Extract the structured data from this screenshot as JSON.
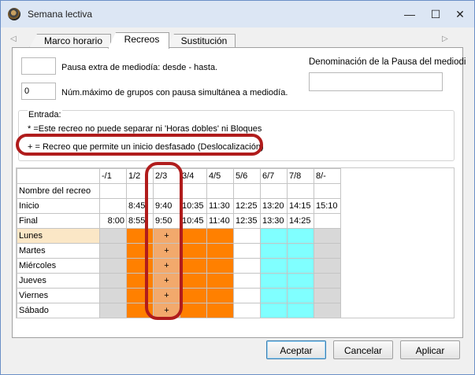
{
  "window": {
    "title": "Semana lectiva",
    "minimize": "—",
    "maximize": "☐",
    "close": "✕"
  },
  "tabs": [
    {
      "label": "Marco horario"
    },
    {
      "label": "Recreos"
    },
    {
      "label": "Sustitución"
    }
  ],
  "tab_scroll": {
    "left": "◁",
    "right": "▷"
  },
  "form": {
    "pause_value": "",
    "pause_label": "Pausa extra de mediodía: desde - hasta.",
    "max_groups_value": "0",
    "max_groups_label": "Núm.máximo de grupos con pausa simultánea a mediodía.",
    "denominacion_label": "Denominación de la Pausa del mediodi",
    "denominacion_value": ""
  },
  "legend": {
    "title": "Entrada:",
    "line1": "* =Este recreo no puede separar ni 'Horas dobles' ni Bloques",
    "line2": "+ = Recreo que permite un inicio desfasado (Deslocalización)"
  },
  "grid": {
    "headers": [
      "",
      "-/1",
      "1/2",
      "2/3",
      "3/4",
      "4/5",
      "5/6",
      "6/7",
      "7/8",
      "8/-"
    ],
    "info_rows": [
      {
        "label": "Nombre del recreo",
        "cells": [
          "",
          "",
          "",
          "",
          "",
          "",
          "",
          "",
          ""
        ]
      },
      {
        "label": "Inicio",
        "cells": [
          "",
          "8:45",
          "9:40",
          "10:35",
          "11:30",
          "12:25",
          "13:20",
          "14:15",
          "15:10"
        ]
      },
      {
        "label": "Final",
        "cells": [
          "8:00",
          "8:55",
          "9:50",
          "10:45",
          "11:40",
          "12:35",
          "13:30",
          "14:25",
          ""
        ]
      }
    ],
    "day_rows": [
      {
        "label": "Lunes",
        "cells": [
          "",
          "",
          "+",
          "",
          "",
          "",
          "",
          "",
          ""
        ]
      },
      {
        "label": "Martes",
        "cells": [
          "",
          "",
          "+",
          "",
          "",
          "",
          "",
          "",
          ""
        ]
      },
      {
        "label": "Miércoles",
        "cells": [
          "",
          "",
          "+",
          "",
          "",
          "",
          "",
          "",
          ""
        ]
      },
      {
        "label": "Jueves",
        "cells": [
          "",
          "",
          "+",
          "",
          "",
          "",
          "",
          "",
          ""
        ]
      },
      {
        "label": "Viernes",
        "cells": [
          "",
          "",
          "+",
          "",
          "",
          "",
          "",
          "",
          ""
        ]
      },
      {
        "label": "Sábado",
        "cells": [
          "",
          "",
          "+",
          "",
          "",
          "",
          "",
          "",
          ""
        ]
      }
    ],
    "colors": {
      "gray": "#d8d8d8",
      "orange": "#ff8000",
      "orange_light": "#f2a96c",
      "white": "#ffffff",
      "cyan": "#80ffff",
      "selected_row": "#fbe7c6"
    }
  },
  "buttons": {
    "accept": "Aceptar",
    "cancel": "Cancelar",
    "apply": "Aplicar"
  },
  "annotation_color": "#b01c1c"
}
